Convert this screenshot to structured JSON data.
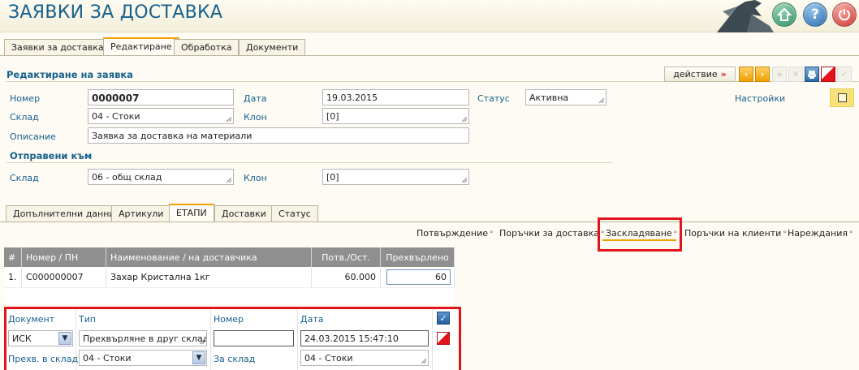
{
  "header": {
    "title": "ЗАЯВКИ ЗА ДОСТАВКА",
    "icons": [
      "home-icon",
      "help-icon",
      "power-icon"
    ]
  },
  "main_tabs": [
    {
      "label": "Заявки за доставка"
    },
    {
      "label": "Редактиране"
    },
    {
      "label": "Обработка"
    },
    {
      "label": "Документи"
    }
  ],
  "edit": {
    "section_title": "Редактиране на заявка",
    "action_label": "действие",
    "settings_label": "Настройки",
    "number_label": "Номер",
    "number_value": "0000007",
    "date_label": "Дата",
    "date_value": "19.03.2015",
    "status_label": "Статус",
    "status_value": "Активна",
    "warehouse_label": "Склад",
    "warehouse_value": "04 - Стоки",
    "branch_label": "Клон",
    "branch_value": "[0]",
    "description_label": "Описание",
    "description_value": "Заявка за доставка на материали"
  },
  "sent_to": {
    "section_title": "Отправени към",
    "warehouse_label": "Склад",
    "warehouse_value": "06 - общ склад",
    "branch_label": "Клон",
    "branch_value": "[0]"
  },
  "sub_tabs": [
    {
      "label": "Допълнителни данни"
    },
    {
      "label": "Артикули"
    },
    {
      "label": "ЕТАПИ"
    },
    {
      "label": "Доставки"
    },
    {
      "label": "Статус"
    }
  ],
  "stages": [
    {
      "label": "Потвърждение"
    },
    {
      "label": "Поръчки за доставка"
    },
    {
      "label": "Заскладяване"
    },
    {
      "label": "Поръчки на клиенти"
    },
    {
      "label": "Нареждания"
    }
  ],
  "table": {
    "columns": [
      "#",
      "Номер / ПН",
      "Наименование / на доставчика",
      "Потв./Ост.",
      "Прехвърлено"
    ],
    "rows": [
      {
        "idx": "1.",
        "number": "C000000007",
        "name": "Захар Кристална 1кг",
        "confirmed": "60.000",
        "transferred": "60"
      }
    ]
  },
  "doc_form": {
    "document_label": "Документ",
    "type_label": "Тип",
    "number_label": "Номер",
    "date_label": "Дата",
    "document_value": "ИСК",
    "type_value": "Прехвърляне в друг склад",
    "number_value": "",
    "date_value": "24.03.2015 15:47:10",
    "transfer_label": "Прехв. в склад",
    "transfer_value": "04 - Стоки",
    "to_warehouse_label": "За склад",
    "to_warehouse_value": "04 - Стоки"
  },
  "colors": {
    "accent": "#17608e",
    "highlight_frame": "#e3131b",
    "table_header": "#8f8f8f",
    "active_tab_top": "#f0a000"
  }
}
